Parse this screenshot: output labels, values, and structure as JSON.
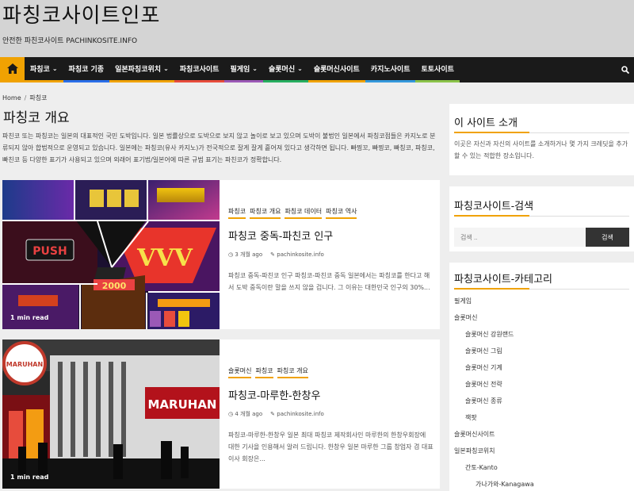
{
  "site": {
    "title": "파칭코사이트인포",
    "tagline": "안전한 파친코사이트 PACHINKOSITE.INFO"
  },
  "nav": [
    {
      "label": "파칭코",
      "has_dropdown": true,
      "color": "#f0a202"
    },
    {
      "label": "파칭코 기종",
      "has_dropdown": false,
      "color": "#2a6ee8"
    },
    {
      "label": "일본파칭코위치",
      "has_dropdown": true,
      "color": "#f0a202"
    },
    {
      "label": "파칭코사이트",
      "has_dropdown": false,
      "color": "#e74c3c"
    },
    {
      "label": "필게임",
      "has_dropdown": true,
      "color": "#9b59b6"
    },
    {
      "label": "슬롯머신",
      "has_dropdown": true,
      "color": "#27ae60"
    },
    {
      "label": "슬롯머신사이트",
      "has_dropdown": false,
      "color": "#f0a202"
    },
    {
      "label": "카지노사이트",
      "has_dropdown": false,
      "color": "#3498db"
    },
    {
      "label": "토토사이트",
      "has_dropdown": false,
      "color": "#8bc34a"
    }
  ],
  "breadcrumb": [
    "Home",
    "파칭코"
  ],
  "page_title": "파칭코 개요",
  "description": "파친코 또는 파칭코는 일본의 대표적인 국민 도박입니다. 일본 법률상으로 도박으로 보지 않고 놀이로 보고 있으며 도박이 불법인 일본에서 파칭코점들은 카지노로 분류되지 않아 합법적으로 운영되고 있습니다. 일본에는 파칭코(유사 카지노)가 전국적으로 잘게 잘게 흩어져 있다고 생각하면 됩니다. 빠찡꼬, 빠찡코, 빠칭코, 파칭코, 빠친코 등 다양한 표기가 사용되고 있으며 외래어 표기법/일본어에 따른 규범 표기는 파친코가 정확합니다.",
  "posts": [
    {
      "categories": [
        "파칭코",
        "파칭코 개요",
        "파칭코 데이터",
        "파칭코 역사"
      ],
      "title": "파칭코 중독-파친코 인구",
      "date": "3 개월 ago",
      "author": "pachinkosite.info",
      "excerpt": "파칭코 중독-파친코 인구 파칭코-파친코 중독 일본에서는 파칭코를 한다고 해서 도박 중독이란 말을 쓰지 않을 겁니다. 그 이유는 대한민국 인구의 30%...",
      "minread": "1 min read"
    },
    {
      "categories": [
        "슬롯머신",
        "파칭코",
        "파칭코 개요"
      ],
      "title": "파칭코-마루한-한창우",
      "date": "4 개월 ago",
      "author": "pachinkosite.info",
      "excerpt": "파칭코-마루한-한창우 일본 최대 파칭코 제작회사인 마루한의 한창우회장에 대한 기사을 인용해서 알려 드립니다. 한창우 일본 마루한 그룹 창업자 겸 대표이사 회장은...",
      "minread": "1 min read"
    }
  ],
  "sidebar": {
    "about_title": "이 사이트 소개",
    "about_text": "이곳은 자신과 자신의 사이트를 소개하거나 몇 가지 크레딧을 추가할 수 있는 적합한 장소입니다.",
    "search_title": "파칭코사이트-검색",
    "search_placeholder": "검색 ..",
    "search_button": "검색",
    "categories_title": "파칭코사이트-카테고리",
    "categories": [
      {
        "label": "필게임",
        "level": 0
      },
      {
        "label": "슬롯머신",
        "level": 0
      },
      {
        "label": "슬롯머신 강원랜드",
        "level": 1
      },
      {
        "label": "슬롯머신 그림",
        "level": 1
      },
      {
        "label": "슬롯머신 기계",
        "level": 1
      },
      {
        "label": "슬롯머신 전략",
        "level": 1
      },
      {
        "label": "슬롯머신 종류",
        "level": 1
      },
      {
        "label": "잭팟",
        "level": 1
      },
      {
        "label": "슬롯머신사이트",
        "level": 0
      },
      {
        "label": "일본파칭코위치",
        "level": 0
      },
      {
        "label": "간토-Kanto",
        "level": 1
      },
      {
        "label": "가나가와-Kanagawa",
        "level": 2
      }
    ]
  },
  "colors": {
    "accent": "#f0a202",
    "nav_bg": "#1a1a1a",
    "header_bg": "#d4d4d4"
  }
}
